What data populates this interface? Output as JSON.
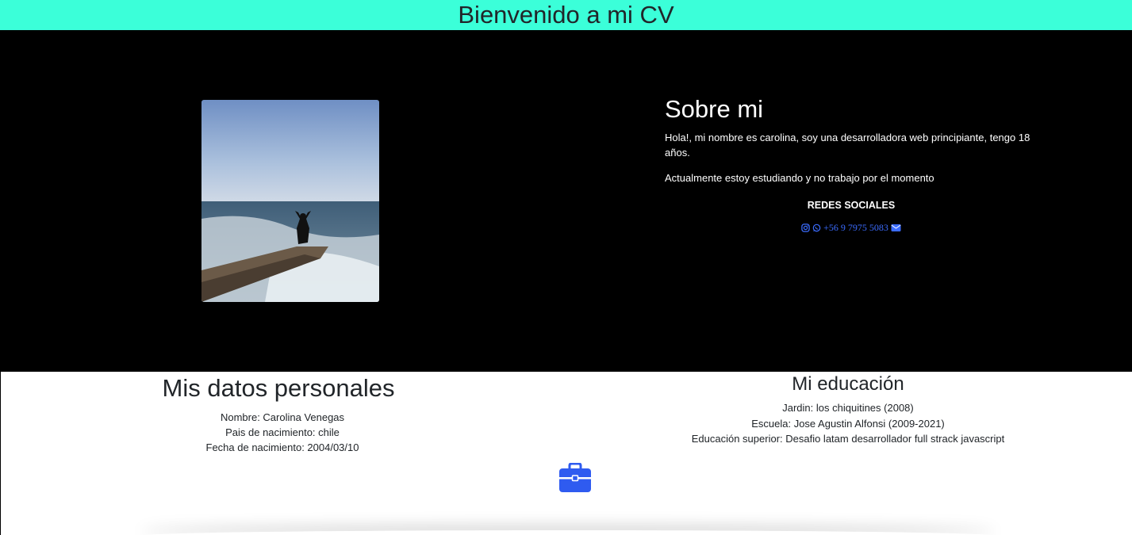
{
  "header": {
    "title": "Bienvenido a mi CV"
  },
  "about": {
    "heading": "Sobre mi",
    "paragraph_1": "Hola!, mi nombre es carolina, soy una desarrolladora web principiante, tengo 18 años.",
    "paragraph_2": "Actualmente estoy estudiando y no trabajo por el momento",
    "social_heading": "REDES SOCIALES",
    "phone": "+56 9 7975 5083",
    "icons": [
      "instagram-icon",
      "whatsapp-icon",
      "envelope-icon"
    ]
  },
  "personal": {
    "heading": "Mis datos personales",
    "items": [
      "Nombre: Carolina Venegas",
      "Pais de nacimiento: chile",
      "Fecha de nacimiento: 2004/03/10"
    ]
  },
  "education": {
    "heading": "Mi educación",
    "items": [
      "Jardin: los chiquitines (2008)",
      "Escuela: Jose Agustin Alfonsi (2009-2021)",
      "Educación superior: Desafio latam desarrollador full strack javascript"
    ]
  },
  "colors": {
    "banner": "#3bffd9",
    "hero_bg": "#000000",
    "link": "#3b6cff",
    "briefcase": "#2f5bf0"
  }
}
